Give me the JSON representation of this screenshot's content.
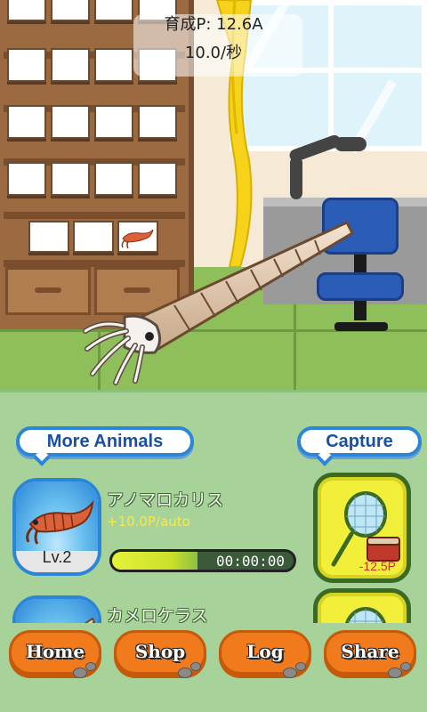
{
  "status": {
    "points_label": "育成P:",
    "points_value": "12.6A",
    "rate_text": "10.0/秒"
  },
  "buttons": {
    "more_animals": "More Animals",
    "capture": "Capture"
  },
  "animals": [
    {
      "name": "アノマロカリス",
      "rate": "+10.0P/auto",
      "level": "Lv.2",
      "timer": "00:00:00",
      "progress": 0.47,
      "capture_cost": "-12.5P"
    },
    {
      "name": "カメロケラス",
      "rate": "",
      "level": "",
      "timer": "",
      "capture_cost": ""
    }
  ],
  "nav": {
    "home": "Home",
    "shop": "Shop",
    "log": "Log",
    "share": "Share"
  },
  "colors": {
    "panel": "#a7d39a",
    "accent_blue": "#2b86d8",
    "nav_orange": "#f07a1c",
    "capture_yellow": "#f2ef3a"
  }
}
